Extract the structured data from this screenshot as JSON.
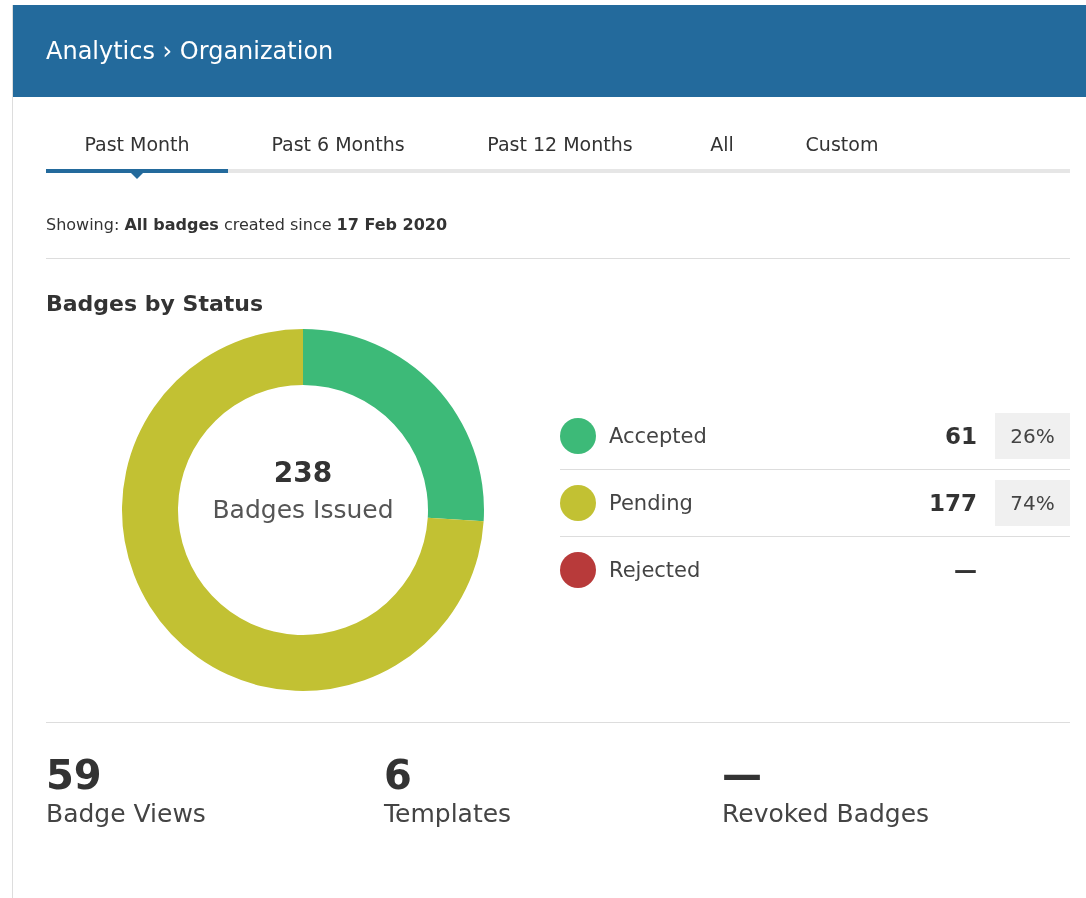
{
  "header": {
    "title": "Analytics › Organization"
  },
  "tabs": [
    {
      "label": "Past Month",
      "selected": true
    },
    {
      "label": "Past 6 Months",
      "selected": false
    },
    {
      "label": "Past 12 Months",
      "selected": false
    },
    {
      "label": "All",
      "selected": false
    },
    {
      "label": "Custom",
      "selected": false
    }
  ],
  "filter_summary": "Showing: **All badges** created since **17 Feb 2020**",
  "status_section": {
    "title": "Badges by Status",
    "chart_data": {
      "type": "donut",
      "categories": [
        "Accepted",
        "Pending",
        "Rejected"
      ],
      "values": [
        26,
        74,
        0
      ]
    },
    "center": {
      "value": "238",
      "label": "Badges Issued"
    },
    "legend": [
      {
        "color": "#3dba78",
        "count": "61",
        "percent": "26%"
      },
      {
        "color": "#c2c133",
        "count": "177",
        "percent": "74%"
      },
      {
        "color": "#b83a3a",
        "count": "—"
      }
    ]
  },
  "stats": [
    {
      "value": "59",
      "label": "Badge Views"
    },
    {
      "value": "6",
      "label": "Templates"
    },
    {
      "value": "—",
      "label": "Revoked Badges"
    }
  ]
}
